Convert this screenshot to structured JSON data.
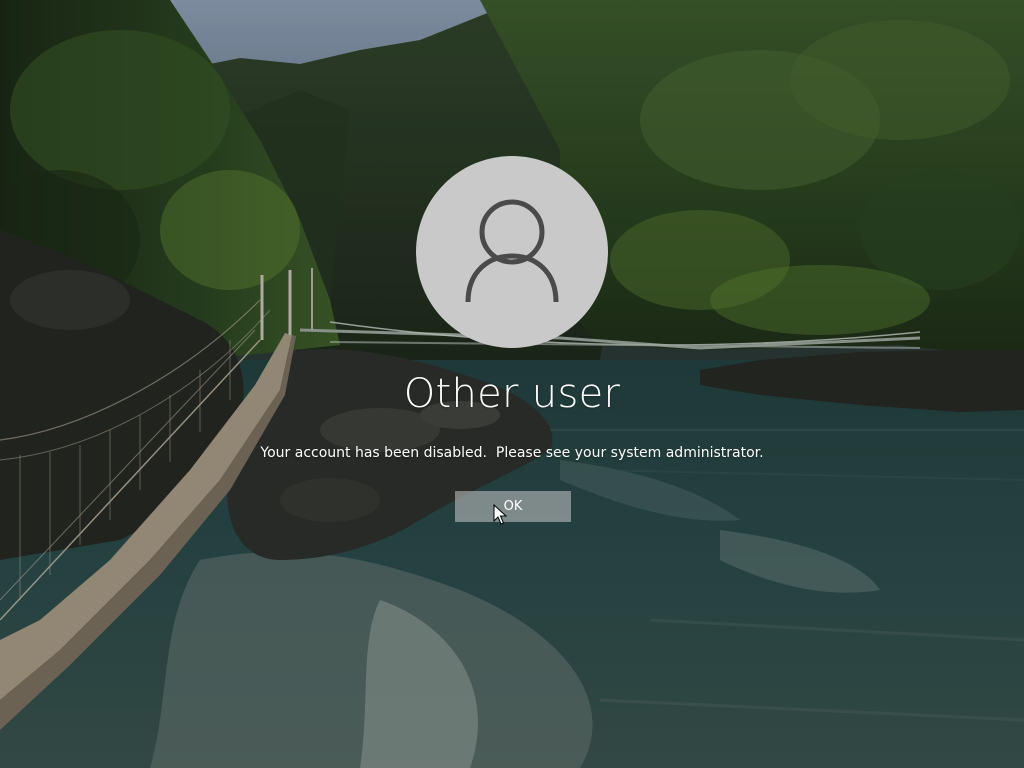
{
  "lock_screen": {
    "avatar_icon": "user-silhouette-icon",
    "username": "Other user",
    "message": "Your account has been disabled.  Please see your system administrator.",
    "ok_label": "OK"
  },
  "colors": {
    "avatar_background": "#c9c9c9",
    "avatar_glyph": "#4a4a4a",
    "text": "#ffffff",
    "button_background": "rgba(200,200,200,0.55)"
  }
}
